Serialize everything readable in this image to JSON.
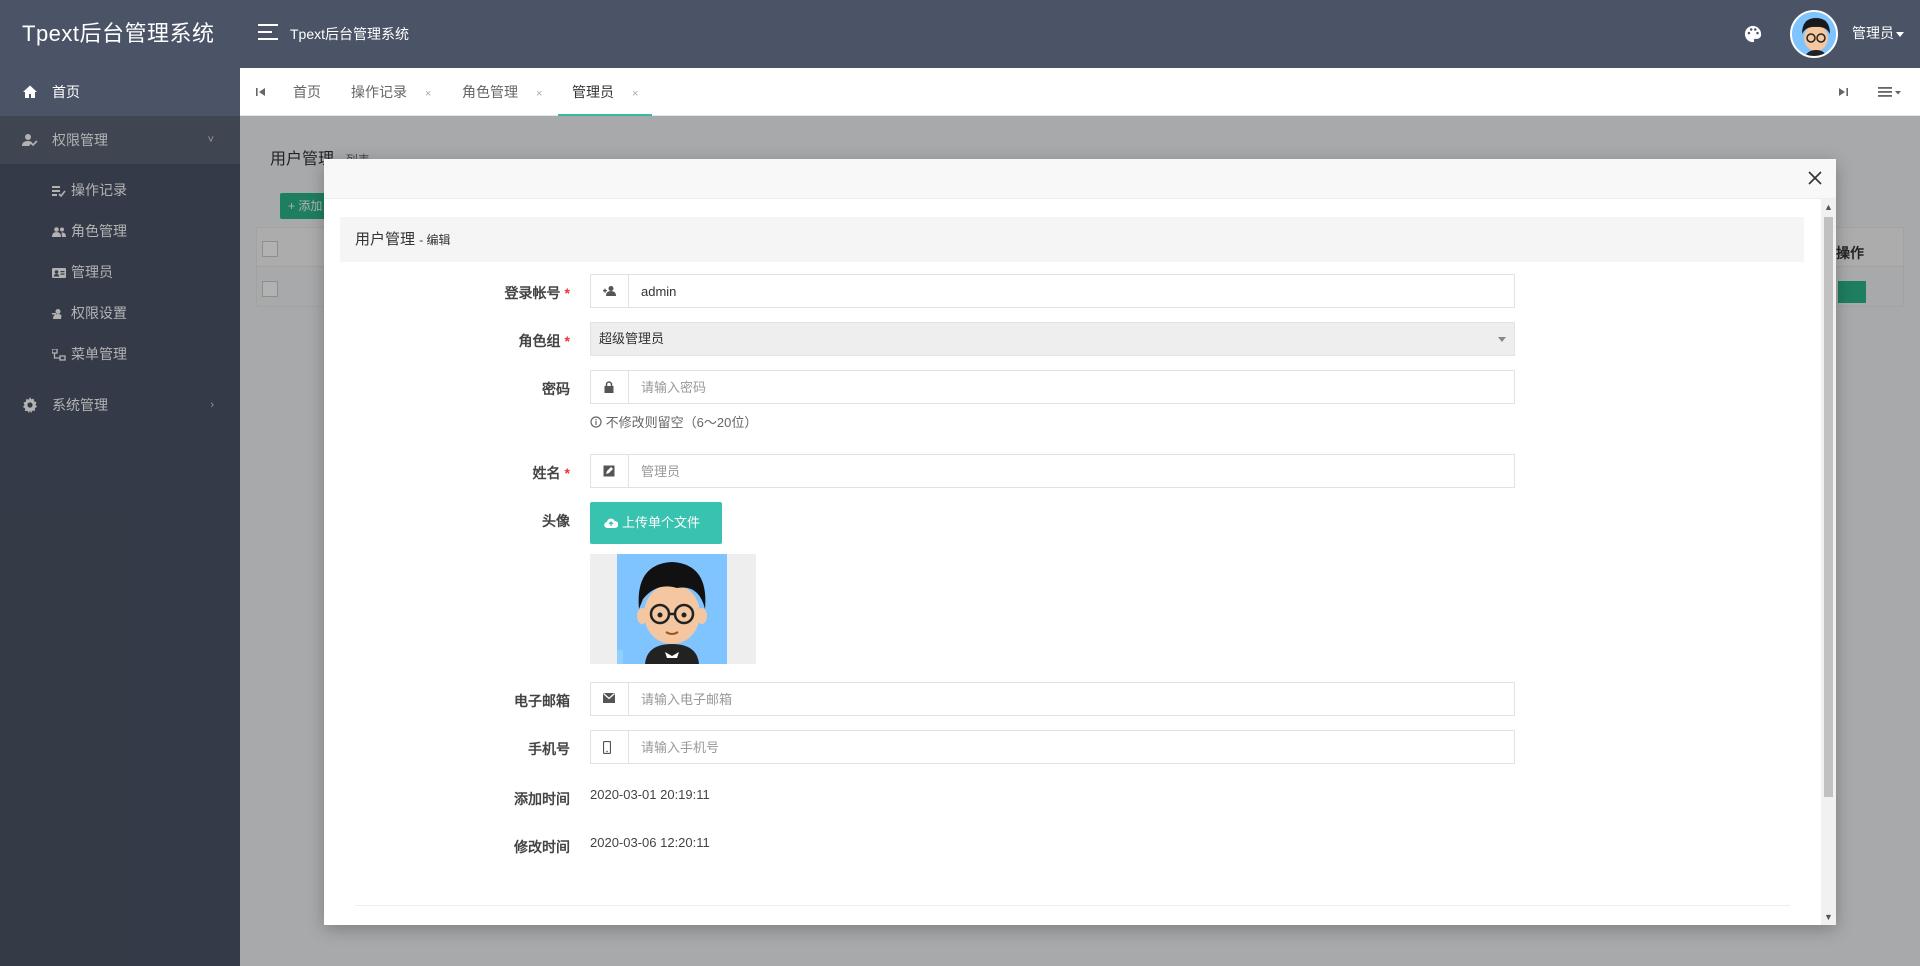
{
  "header": {
    "brand": "Tpext后台管理系统",
    "title": "Tpext后台管理系统",
    "user_name": "管理员"
  },
  "sidebar": {
    "items": [
      {
        "label": "首页",
        "icon": "home-icon"
      },
      {
        "label": "权限管理",
        "icon": "user-check-icon",
        "chevron": "˅"
      },
      {
        "label": "系统管理",
        "icon": "gear-icon",
        "chevron": "›"
      }
    ],
    "sub_items": [
      {
        "label": "操作记录",
        "icon": "list-check-icon"
      },
      {
        "label": "角色管理",
        "icon": "users-icon"
      },
      {
        "label": "管理员",
        "icon": "id-card-icon"
      },
      {
        "label": "权限设置",
        "icon": "user-key-icon"
      },
      {
        "label": "菜单管理",
        "icon": "sitemap-icon"
      }
    ]
  },
  "tabs": [
    {
      "label": "首页",
      "close": ""
    },
    {
      "label": "操作记录",
      "close": "×"
    },
    {
      "label": "角色管理",
      "close": "×"
    },
    {
      "label": "管理员",
      "close": "×"
    }
  ],
  "background_page": {
    "title": "用户管理",
    "subtitle": "- 列表",
    "add_button": "+ 添加",
    "op_header": "操作"
  },
  "modal": {
    "form_title": "用户管理",
    "form_subtitle": "- 编辑",
    "fields": {
      "username": {
        "label": "登录帐号",
        "required": "*",
        "value": "admin",
        "placeholder": "admin"
      },
      "role": {
        "label": "角色组",
        "required": "*",
        "value": "超级管理员"
      },
      "password": {
        "label": "密码",
        "placeholder": "请输入密码",
        "help": "不修改则留空（6～20位）"
      },
      "name": {
        "label": "姓名",
        "required": "*",
        "placeholder": "管理员"
      },
      "avatar": {
        "label": "头像",
        "upload_label": "上传单个文件"
      },
      "email": {
        "label": "电子邮箱",
        "placeholder": "请输入电子邮箱"
      },
      "phone": {
        "label": "手机号",
        "placeholder": "请输入手机号"
      },
      "created": {
        "label": "添加时间",
        "value": "2020-03-01 20:19:11"
      },
      "updated": {
        "label": "修改时间",
        "value": "2020-03-06 12:20:11"
      }
    }
  },
  "colors": {
    "sidebar_bg": "#4b5466",
    "accent": "#38c2b0",
    "required": "#e33333"
  }
}
